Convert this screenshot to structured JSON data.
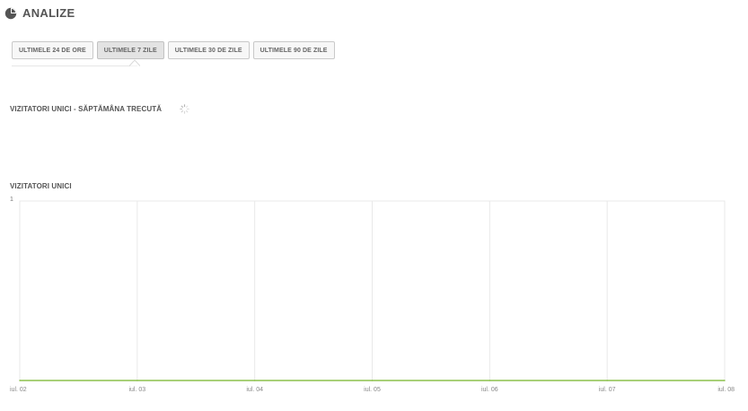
{
  "header": {
    "title": "ANALIZE",
    "icon": "pie-chart-icon"
  },
  "tabs": [
    {
      "label": "ULTIMELE 24 DE ORE",
      "active": false
    },
    {
      "label": "ULTIMELE 7 ZILE",
      "active": true
    },
    {
      "label": "ULTIMELE 30 DE ZILE",
      "active": false
    },
    {
      "label": "ULTIMELE 90 DE ZILE",
      "active": false
    }
  ],
  "sections": {
    "last_week_title": "VIZITATORI UNICI - SĂPTĂMÂNA TRECUTĂ",
    "chart_title": "VIZITATORI UNICI"
  },
  "colors": {
    "line": "#8cc14c",
    "grid": "#e9e9e9"
  },
  "chart_data": {
    "type": "line",
    "title": "VIZITATORI UNICI",
    "categories": [
      "iul. 02",
      "iul. 03",
      "iul. 04",
      "iul. 05",
      "iul. 06",
      "iul. 07",
      "iul. 08"
    ],
    "values": [
      0,
      0,
      0,
      0,
      0,
      0,
      0
    ],
    "ylim": [
      0,
      1
    ],
    "y_ticks": [
      "1"
    ],
    "grid": true,
    "xlabel": "",
    "ylabel": ""
  }
}
